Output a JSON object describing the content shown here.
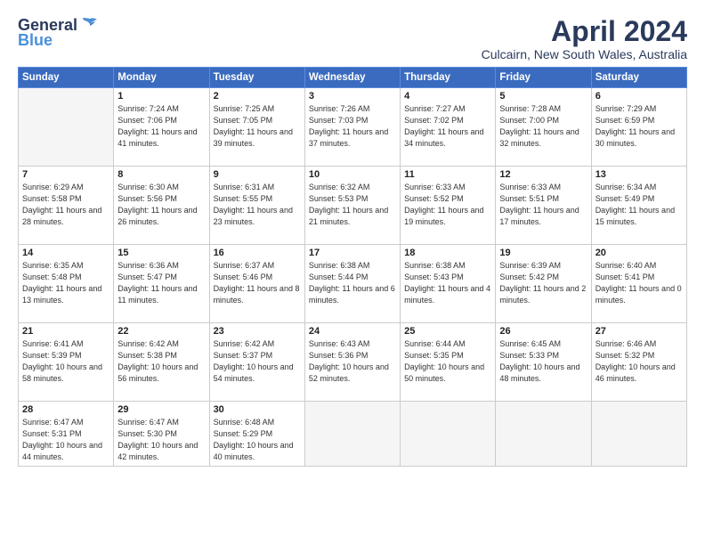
{
  "header": {
    "logo_line1": "General",
    "logo_line2": "Blue",
    "month_title": "April 2024",
    "location": "Culcairn, New South Wales, Australia"
  },
  "weekdays": [
    "Sunday",
    "Monday",
    "Tuesday",
    "Wednesday",
    "Thursday",
    "Friday",
    "Saturday"
  ],
  "weeks": [
    [
      {
        "day": "",
        "sunrise": "",
        "sunset": "",
        "daylight": ""
      },
      {
        "day": "1",
        "sunrise": "Sunrise: 7:24 AM",
        "sunset": "Sunset: 7:06 PM",
        "daylight": "Daylight: 11 hours and 41 minutes."
      },
      {
        "day": "2",
        "sunrise": "Sunrise: 7:25 AM",
        "sunset": "Sunset: 7:05 PM",
        "daylight": "Daylight: 11 hours and 39 minutes."
      },
      {
        "day": "3",
        "sunrise": "Sunrise: 7:26 AM",
        "sunset": "Sunset: 7:03 PM",
        "daylight": "Daylight: 11 hours and 37 minutes."
      },
      {
        "day": "4",
        "sunrise": "Sunrise: 7:27 AM",
        "sunset": "Sunset: 7:02 PM",
        "daylight": "Daylight: 11 hours and 34 minutes."
      },
      {
        "day": "5",
        "sunrise": "Sunrise: 7:28 AM",
        "sunset": "Sunset: 7:00 PM",
        "daylight": "Daylight: 11 hours and 32 minutes."
      },
      {
        "day": "6",
        "sunrise": "Sunrise: 7:29 AM",
        "sunset": "Sunset: 6:59 PM",
        "daylight": "Daylight: 11 hours and 30 minutes."
      }
    ],
    [
      {
        "day": "7",
        "sunrise": "Sunrise: 6:29 AM",
        "sunset": "Sunset: 5:58 PM",
        "daylight": "Daylight: 11 hours and 28 minutes."
      },
      {
        "day": "8",
        "sunrise": "Sunrise: 6:30 AM",
        "sunset": "Sunset: 5:56 PM",
        "daylight": "Daylight: 11 hours and 26 minutes."
      },
      {
        "day": "9",
        "sunrise": "Sunrise: 6:31 AM",
        "sunset": "Sunset: 5:55 PM",
        "daylight": "Daylight: 11 hours and 23 minutes."
      },
      {
        "day": "10",
        "sunrise": "Sunrise: 6:32 AM",
        "sunset": "Sunset: 5:53 PM",
        "daylight": "Daylight: 11 hours and 21 minutes."
      },
      {
        "day": "11",
        "sunrise": "Sunrise: 6:33 AM",
        "sunset": "Sunset: 5:52 PM",
        "daylight": "Daylight: 11 hours and 19 minutes."
      },
      {
        "day": "12",
        "sunrise": "Sunrise: 6:33 AM",
        "sunset": "Sunset: 5:51 PM",
        "daylight": "Daylight: 11 hours and 17 minutes."
      },
      {
        "day": "13",
        "sunrise": "Sunrise: 6:34 AM",
        "sunset": "Sunset: 5:49 PM",
        "daylight": "Daylight: 11 hours and 15 minutes."
      }
    ],
    [
      {
        "day": "14",
        "sunrise": "Sunrise: 6:35 AM",
        "sunset": "Sunset: 5:48 PM",
        "daylight": "Daylight: 11 hours and 13 minutes."
      },
      {
        "day": "15",
        "sunrise": "Sunrise: 6:36 AM",
        "sunset": "Sunset: 5:47 PM",
        "daylight": "Daylight: 11 hours and 11 minutes."
      },
      {
        "day": "16",
        "sunrise": "Sunrise: 6:37 AM",
        "sunset": "Sunset: 5:46 PM",
        "daylight": "Daylight: 11 hours and 8 minutes."
      },
      {
        "day": "17",
        "sunrise": "Sunrise: 6:38 AM",
        "sunset": "Sunset: 5:44 PM",
        "daylight": "Daylight: 11 hours and 6 minutes."
      },
      {
        "day": "18",
        "sunrise": "Sunrise: 6:38 AM",
        "sunset": "Sunset: 5:43 PM",
        "daylight": "Daylight: 11 hours and 4 minutes."
      },
      {
        "day": "19",
        "sunrise": "Sunrise: 6:39 AM",
        "sunset": "Sunset: 5:42 PM",
        "daylight": "Daylight: 11 hours and 2 minutes."
      },
      {
        "day": "20",
        "sunrise": "Sunrise: 6:40 AM",
        "sunset": "Sunset: 5:41 PM",
        "daylight": "Daylight: 11 hours and 0 minutes."
      }
    ],
    [
      {
        "day": "21",
        "sunrise": "Sunrise: 6:41 AM",
        "sunset": "Sunset: 5:39 PM",
        "daylight": "Daylight: 10 hours and 58 minutes."
      },
      {
        "day": "22",
        "sunrise": "Sunrise: 6:42 AM",
        "sunset": "Sunset: 5:38 PM",
        "daylight": "Daylight: 10 hours and 56 minutes."
      },
      {
        "day": "23",
        "sunrise": "Sunrise: 6:42 AM",
        "sunset": "Sunset: 5:37 PM",
        "daylight": "Daylight: 10 hours and 54 minutes."
      },
      {
        "day": "24",
        "sunrise": "Sunrise: 6:43 AM",
        "sunset": "Sunset: 5:36 PM",
        "daylight": "Daylight: 10 hours and 52 minutes."
      },
      {
        "day": "25",
        "sunrise": "Sunrise: 6:44 AM",
        "sunset": "Sunset: 5:35 PM",
        "daylight": "Daylight: 10 hours and 50 minutes."
      },
      {
        "day": "26",
        "sunrise": "Sunrise: 6:45 AM",
        "sunset": "Sunset: 5:33 PM",
        "daylight": "Daylight: 10 hours and 48 minutes."
      },
      {
        "day": "27",
        "sunrise": "Sunrise: 6:46 AM",
        "sunset": "Sunset: 5:32 PM",
        "daylight": "Daylight: 10 hours and 46 minutes."
      }
    ],
    [
      {
        "day": "28",
        "sunrise": "Sunrise: 6:47 AM",
        "sunset": "Sunset: 5:31 PM",
        "daylight": "Daylight: 10 hours and 44 minutes."
      },
      {
        "day": "29",
        "sunrise": "Sunrise: 6:47 AM",
        "sunset": "Sunset: 5:30 PM",
        "daylight": "Daylight: 10 hours and 42 minutes."
      },
      {
        "day": "30",
        "sunrise": "Sunrise: 6:48 AM",
        "sunset": "Sunset: 5:29 PM",
        "daylight": "Daylight: 10 hours and 40 minutes."
      },
      {
        "day": "",
        "sunrise": "",
        "sunset": "",
        "daylight": ""
      },
      {
        "day": "",
        "sunrise": "",
        "sunset": "",
        "daylight": ""
      },
      {
        "day": "",
        "sunrise": "",
        "sunset": "",
        "daylight": ""
      },
      {
        "day": "",
        "sunrise": "",
        "sunset": "",
        "daylight": ""
      }
    ]
  ]
}
